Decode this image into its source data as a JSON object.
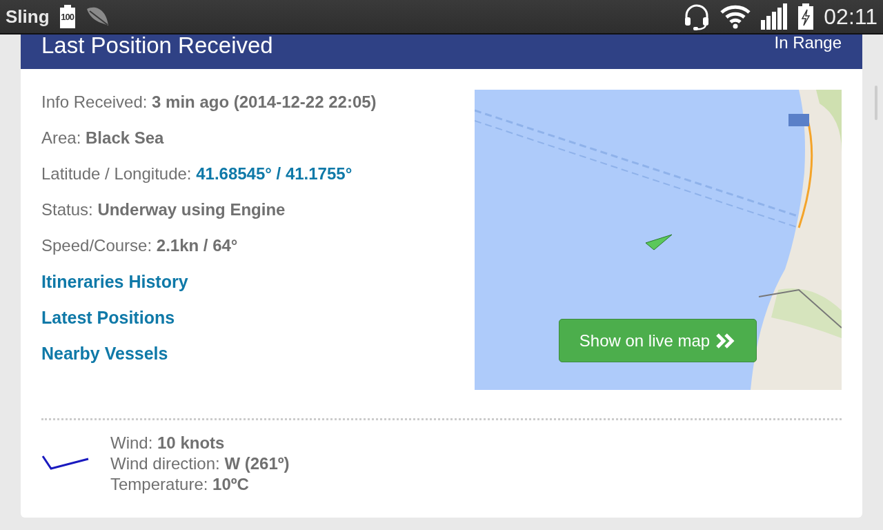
{
  "status_bar": {
    "app": "Sling",
    "battery_label": "100",
    "time": "02:11"
  },
  "panel": {
    "title": "Last Position Received",
    "status": "In Range"
  },
  "info": [
    {
      "label": "Info Received: ",
      "value": "3 min ago (2014-12-22 22:05)",
      "kind": "text"
    },
    {
      "label": "Area: ",
      "value": "Black Sea",
      "kind": "text"
    },
    {
      "label": "Latitude / Longitude: ",
      "value": "41.68545° / 41.1755°",
      "kind": "link"
    },
    {
      "label": "Status: ",
      "value": "Underway using Engine",
      "kind": "text"
    },
    {
      "label": "Speed/Course: ",
      "value": "2.1kn / 64°",
      "kind": "text"
    }
  ],
  "links": [
    "Itineraries History",
    "Latest Positions",
    "Nearby Vessels"
  ],
  "map": {
    "kind": "picture",
    "button": "Show on live map"
  },
  "weather": [
    "Wind: **10 knots**",
    "Wind direction: **W (261º)**",
    "Temperature: **10ºC**"
  ]
}
